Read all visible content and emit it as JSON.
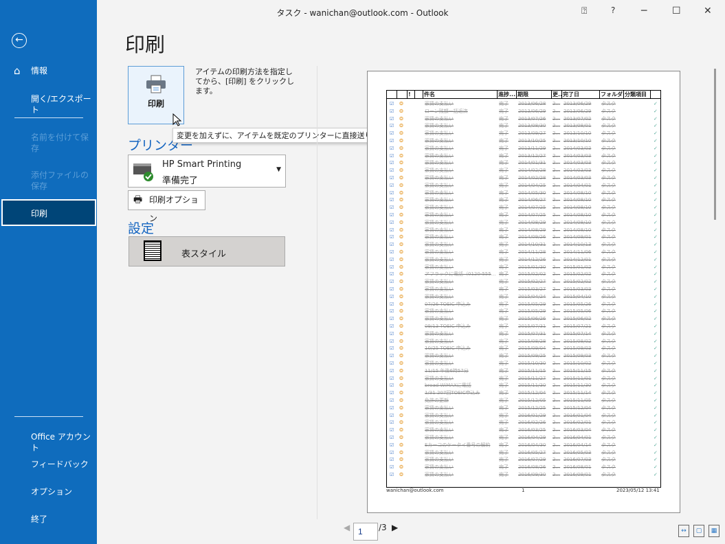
{
  "window": {
    "title": "タスク - wanichan@outlook.com  -  Outlook",
    "buttons": {
      "feedback": "feedback-icon",
      "help": "?",
      "minimize": "─",
      "maximize": "☐",
      "close": "✕"
    }
  },
  "sidebar": {
    "back": "←",
    "items": [
      {
        "label": "情報",
        "icon": "home-icon"
      },
      {
        "label": "開く/エクスポート"
      },
      {
        "label": "名前を付けて保存",
        "disabled": true
      },
      {
        "label": "添付ファイルの保存",
        "disabled": true
      },
      {
        "label": "印刷",
        "selected": true
      },
      {
        "label": "Office アカウント"
      },
      {
        "label": "フィードバック"
      },
      {
        "label": "オプション"
      },
      {
        "label": "終了"
      }
    ]
  },
  "main": {
    "title": "印刷",
    "print_button": "印刷",
    "description": "アイテムの印刷方法を指定してから、[印刷] をクリックします。",
    "tooltip": "変更を加えずに、アイテムを既定のプリンターに直接送ります。",
    "printer_heading": "プリンター",
    "printer": {
      "name": "HP Smart Printing",
      "status": "準備完了"
    },
    "print_options": "印刷オプション",
    "settings_heading": "設定",
    "style": "表スタイル"
  },
  "preview": {
    "headers": [
      "",
      "",
      "!",
      "",
      "件名",
      "進捗...",
      "期限",
      "更...",
      "完了日",
      "フォルダー",
      "分類項目",
      ""
    ],
    "status": "完了",
    "start": "2...",
    "folder": "タスク",
    "rows": [
      [
        "家賃の支払い",
        "2013/06/28",
        "2013/06/29"
      ],
      [
        "ローン残額一括返済",
        "2013/06/29",
        "2013/06/29"
      ],
      [
        "家賃の支払い",
        "2013/07/26",
        "2013/07/02"
      ],
      [
        "家賃の支払い",
        "2013/08/30",
        "2013/08/01"
      ],
      [
        "家賃の支払い",
        "2013/09/27",
        "2013/10/10"
      ],
      [
        "家賃の支払い",
        "2013/10/25",
        "2013/10/10"
      ],
      [
        "家賃の支払い",
        "2013/11/29",
        "2014/03/03"
      ],
      [
        "家賃の支払い",
        "2013/12/27",
        "2014/03/03"
      ],
      [
        "家賃の支払い",
        "2014/01/31",
        "2014/03/03"
      ],
      [
        "家賃の支払い",
        "2014/02/28",
        "2014/03/03"
      ],
      [
        "家賃の支払い",
        "2014/02/28",
        "2014/03/03"
      ],
      [
        "家賃の支払い",
        "2014/04/25",
        "2014/04/01"
      ],
      [
        "家賃の支払い",
        "2014/05/30",
        "2014/08/10"
      ],
      [
        "家賃の支払い",
        "2014/06/27",
        "2014/08/10"
      ],
      [
        "家賃の支払い",
        "2014/07/25",
        "2014/08/10"
      ],
      [
        "家賃の支払い",
        "2014/07/25",
        "2014/08/10"
      ],
      [
        "家賃の支払い",
        "2014/08/29",
        "2014/08/10"
      ],
      [
        "家賃の支払い",
        "2014/08/29",
        "2014/08/10"
      ],
      [
        "家賃の支払い",
        "2014/09/26",
        "2014/09/01"
      ],
      [
        "家賃の支払い",
        "2014/10/31",
        "2014/10/13"
      ],
      [
        "家賃の支払い",
        "2014/11/28",
        "2014/11/06"
      ],
      [
        "家賃の支払い",
        "2014/12/26",
        "2014/12/01"
      ],
      [
        "家賃の支払い",
        "2015/01/30",
        "2015/01/02"
      ],
      [
        "アフラックに電話（0120-555-725）",
        "2015/02/02",
        "2015/02/02"
      ],
      [
        "家賃の支払い",
        "2015/02/27",
        "2015/02/02"
      ],
      [
        "家賃の支払い",
        "2015/03/27",
        "2015/03/03"
      ],
      [
        "家賃の支払い",
        "2015/04/24",
        "2015/04/10"
      ],
      [
        "07/26 TOEIC 申込み",
        "2015/05/29",
        "2015/05/26"
      ],
      [
        "家賃の支払い",
        "2015/05/29",
        "2015/05/06"
      ],
      [
        "家賃の支払い",
        "2015/06/26",
        "2015/06/02"
      ],
      [
        "09/13 TOEIC 申込み",
        "2015/07/31",
        "2015/07/21"
      ],
      [
        "家賃の支払い",
        "2015/07/31",
        "2015/07/14"
      ],
      [
        "家賃の支払い",
        "2015/08/28",
        "2015/08/02"
      ],
      [
        "10/25 TOEIC 申込み",
        "2015/09/04",
        "2015/09/03"
      ],
      [
        "家賃の支払い",
        "2015/09/25",
        "2015/09/03"
      ],
      [
        "家賃の支払い",
        "2015/10/30",
        "2015/10/02"
      ],
      [
        "11/15 午後6時57分",
        "2015/11/15",
        "2015/11/15"
      ],
      [
        "家賃の支払い",
        "2015/11/27",
        "2015/11/01"
      ],
      [
        "broad WiMAXに電話",
        "2015/11/30",
        "2015/11/30"
      ],
      [
        "1/31 207回TOEIC申込み",
        "2015/12/04",
        "2015/11/14"
      ],
      [
        "免許の更新",
        "2015/12/05",
        "2015/11/05"
      ],
      [
        "家賃の支払い",
        "2015/12/25",
        "2015/12/04"
      ],
      [
        "家賃の支払い",
        "2016/01/29",
        "2016/01/04"
      ],
      [
        "家賃の支払い",
        "2016/02/26",
        "2016/02/01"
      ],
      [
        "家賃の支払い",
        "2016/03/25",
        "2016/03/04"
      ],
      [
        "家賃の支払い",
        "2016/04/29",
        "2016/04/01"
      ],
      [
        "Eカーコのケータイ番号の解約",
        "2016/04/30",
        "2016/04/14"
      ],
      [
        "家賃の支払い",
        "2016/05/27",
        "2016/05/03"
      ],
      [
        "家賃の支払い",
        "2016/07/29",
        "2016/07/03"
      ],
      [
        "家賃の支払い",
        "2016/08/26",
        "2016/08/01"
      ],
      [
        "家賃の支払い",
        "2016/09/30",
        "2016/09/01"
      ]
    ],
    "footer": {
      "email": "wanichan@outlook.com",
      "page": "1",
      "datetime": "2023/05/12 13:41"
    }
  },
  "pager": {
    "current": "1",
    "total": "/3"
  }
}
